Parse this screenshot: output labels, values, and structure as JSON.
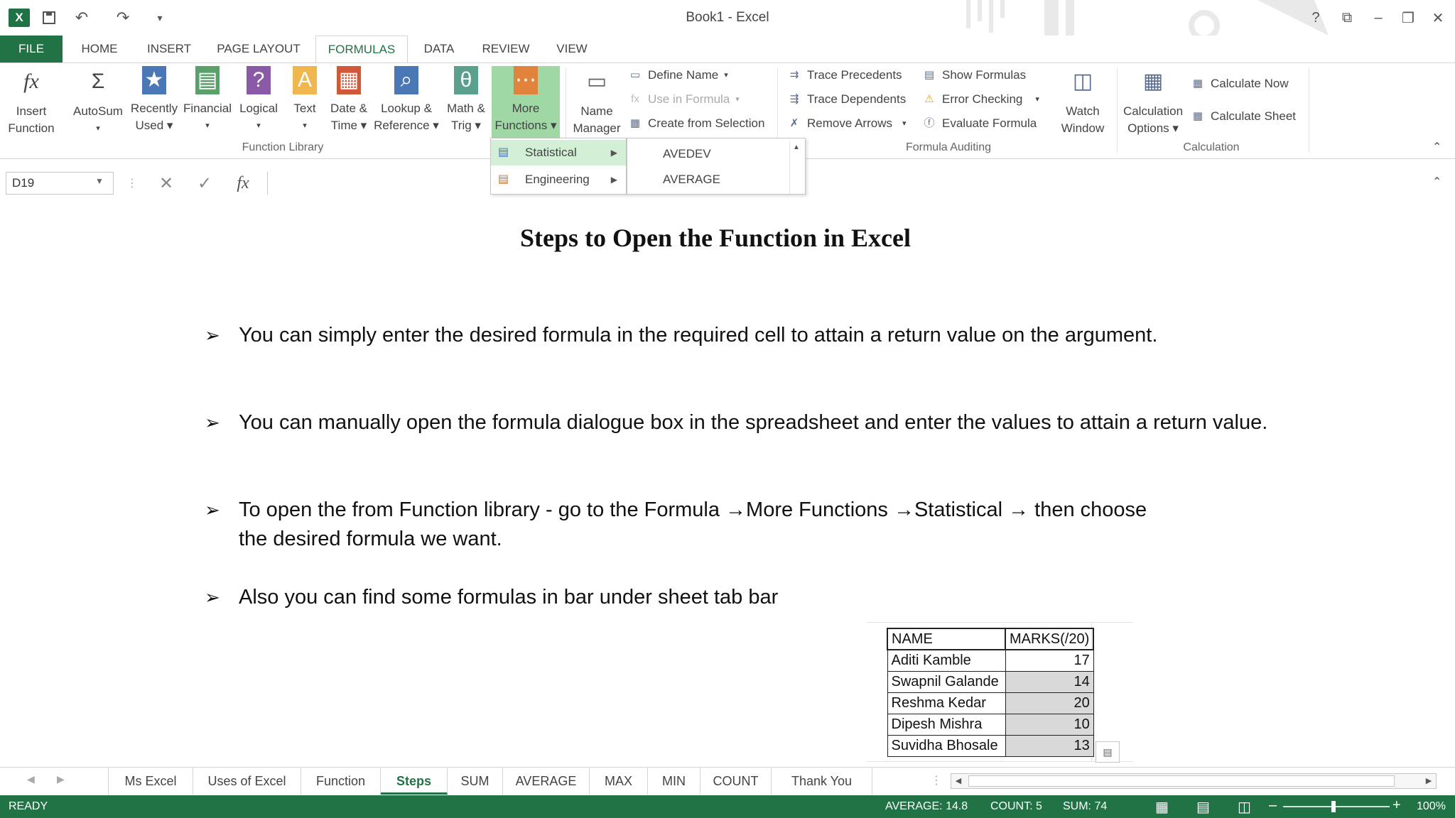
{
  "titlebar": {
    "title": "Book1 - Excel",
    "app_badge": "X",
    "controls": {
      "help": "?",
      "ribbon_options": "⧉",
      "minimize": "–",
      "restore": "❐",
      "close": "✕"
    }
  },
  "ribbon_tabs": [
    "FILE",
    "HOME",
    "INSERT",
    "PAGE LAYOUT",
    "FORMULAS",
    "DATA",
    "REVIEW",
    "VIEW"
  ],
  "active_tab": "FORMULAS",
  "function_library": {
    "group_label": "Function Library",
    "buttons": [
      {
        "line1": "Insert",
        "line2": "Function",
        "icon": "fx"
      },
      {
        "line1": "AutoSum",
        "line2": "▾",
        "icon": "Σ"
      },
      {
        "line1": "Recently",
        "line2": "Used ▾",
        "icon": "★"
      },
      {
        "line1": "Financial",
        "line2": "▾",
        "icon": "▤"
      },
      {
        "line1": "Logical",
        "line2": "▾",
        "icon": "?"
      },
      {
        "line1": "Text",
        "line2": "▾",
        "icon": "A"
      },
      {
        "line1": "Date &",
        "line2": "Time ▾",
        "icon": "▦"
      },
      {
        "line1": "Lookup &",
        "line2": "Reference ▾",
        "icon": "⌕"
      },
      {
        "line1": "Math &",
        "line2": "Trig ▾",
        "icon": "θ"
      },
      {
        "line1": "More",
        "line2": "Functions ▾",
        "icon": "⋯"
      }
    ]
  },
  "defined_names": {
    "name_manager": {
      "line1": "Name",
      "line2": "Manager"
    },
    "define_name": "Define Name",
    "use_in_formula": "Use in Formula",
    "create_from_selection": "Create from Selection"
  },
  "formula_auditing": {
    "group_label": "Formula Auditing",
    "trace_precedents": "Trace Precedents",
    "trace_dependents": "Trace Dependents",
    "remove_arrows": "Remove Arrows",
    "show_formulas": "Show Formulas",
    "error_checking": "Error Checking",
    "evaluate_formula": "Evaluate Formula",
    "watch_window": {
      "line1": "Watch",
      "line2": "Window"
    }
  },
  "calculation": {
    "group_label": "Calculation",
    "options": {
      "line1": "Calculation",
      "line2": "Options ▾"
    },
    "calculate_now": "Calculate Now",
    "calculate_sheet": "Calculate Sheet"
  },
  "more_functions_menu": {
    "items": [
      {
        "label": "Statistical",
        "highlighted": true
      },
      {
        "label": "Engineering",
        "highlighted": false
      }
    ],
    "submenu": [
      "AVEDEV",
      "AVERAGE"
    ]
  },
  "formula_bar": {
    "name_box": "D19",
    "cancel": "✕",
    "enter": "✓",
    "fx": "fx",
    "value": ""
  },
  "slide": {
    "heading": "Steps to Open the Function in Excel",
    "bullet_mark": "➢",
    "bullets": [
      "You  can simply enter the desired formula in the required cell to attain a return value on the argument.",
      "You can manually open the formula dialogue box in the spreadsheet and enter the values to attain a return value.",
      "To open the from Function library - go to the Formula →More Functions →Statistical → then choose the desired formula we want.",
      "Also you can find some formulas in bar under sheet tab bar"
    ]
  },
  "marks_table": {
    "headers": [
      "NAME",
      "MARKS(/20)"
    ],
    "rows": [
      [
        "Aditi Kamble",
        "17"
      ],
      [
        "Swapnil Galande",
        "14"
      ],
      [
        "Reshma Kedar",
        "20"
      ],
      [
        "Dipesh Mishra",
        "10"
      ],
      [
        "Suvidha Bhosale",
        "13"
      ]
    ]
  },
  "sheet_tabs": [
    "Ms Excel",
    "Uses of Excel",
    "Function",
    "Steps",
    "SUM",
    "AVERAGE",
    "MAX",
    "MIN",
    "COUNT",
    "Thank You"
  ],
  "active_sheet": "Steps",
  "status_bar": {
    "mode": "READY",
    "average": "AVERAGE: 14.8",
    "count": "COUNT: 5",
    "sum": "SUM: 74",
    "zoom": "100%",
    "zoom_minus": "–",
    "zoom_plus": "+"
  },
  "colors": {
    "accent": "#217346",
    "highlight": "#9fd7a5",
    "selection": "#d9d9d9"
  }
}
